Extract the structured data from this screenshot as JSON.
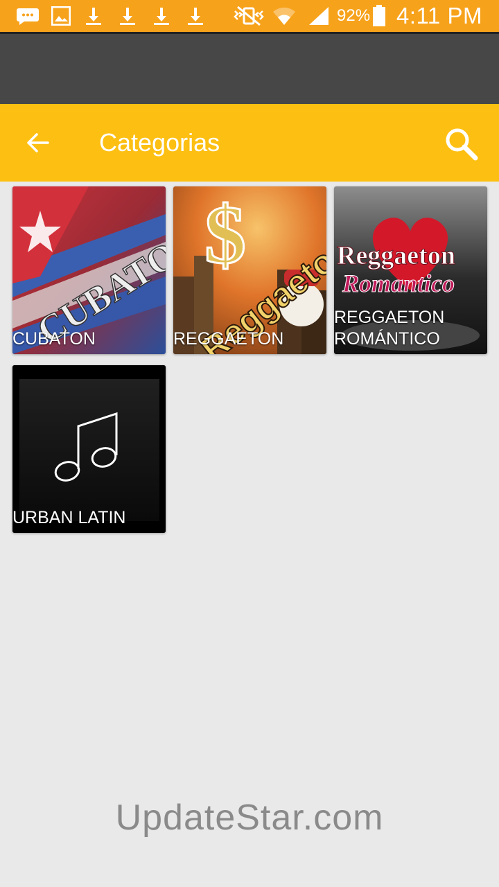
{
  "status_bar": {
    "battery": "92%",
    "time": "4:11 PM",
    "icons": [
      "message-icon",
      "image-icon",
      "download-icon",
      "download-icon",
      "download-icon",
      "download-icon",
      "vibrate-mute-icon",
      "wifi-icon",
      "signal-icon",
      "battery-icon"
    ]
  },
  "toolbar": {
    "title": "Categorias",
    "back_icon": "arrow-back-icon",
    "search_icon": "search-icon"
  },
  "categories": [
    {
      "label": "CUBATON",
      "art_text": "CUBATON"
    },
    {
      "label": "REGGAETON",
      "art_text": "Reggaeton"
    },
    {
      "label": "REGGAETON ROMÁNTICO",
      "art_text_1": "Reggaeton",
      "art_text_2": "Romantico"
    },
    {
      "label": "URBAN LATIN"
    }
  ],
  "watermark": "UpdateStar.com",
  "colors": {
    "status_bar": "#f7a21b",
    "toolbar": "#fdbf12",
    "background": "#e9e9e9",
    "dark_band": "#474747"
  }
}
